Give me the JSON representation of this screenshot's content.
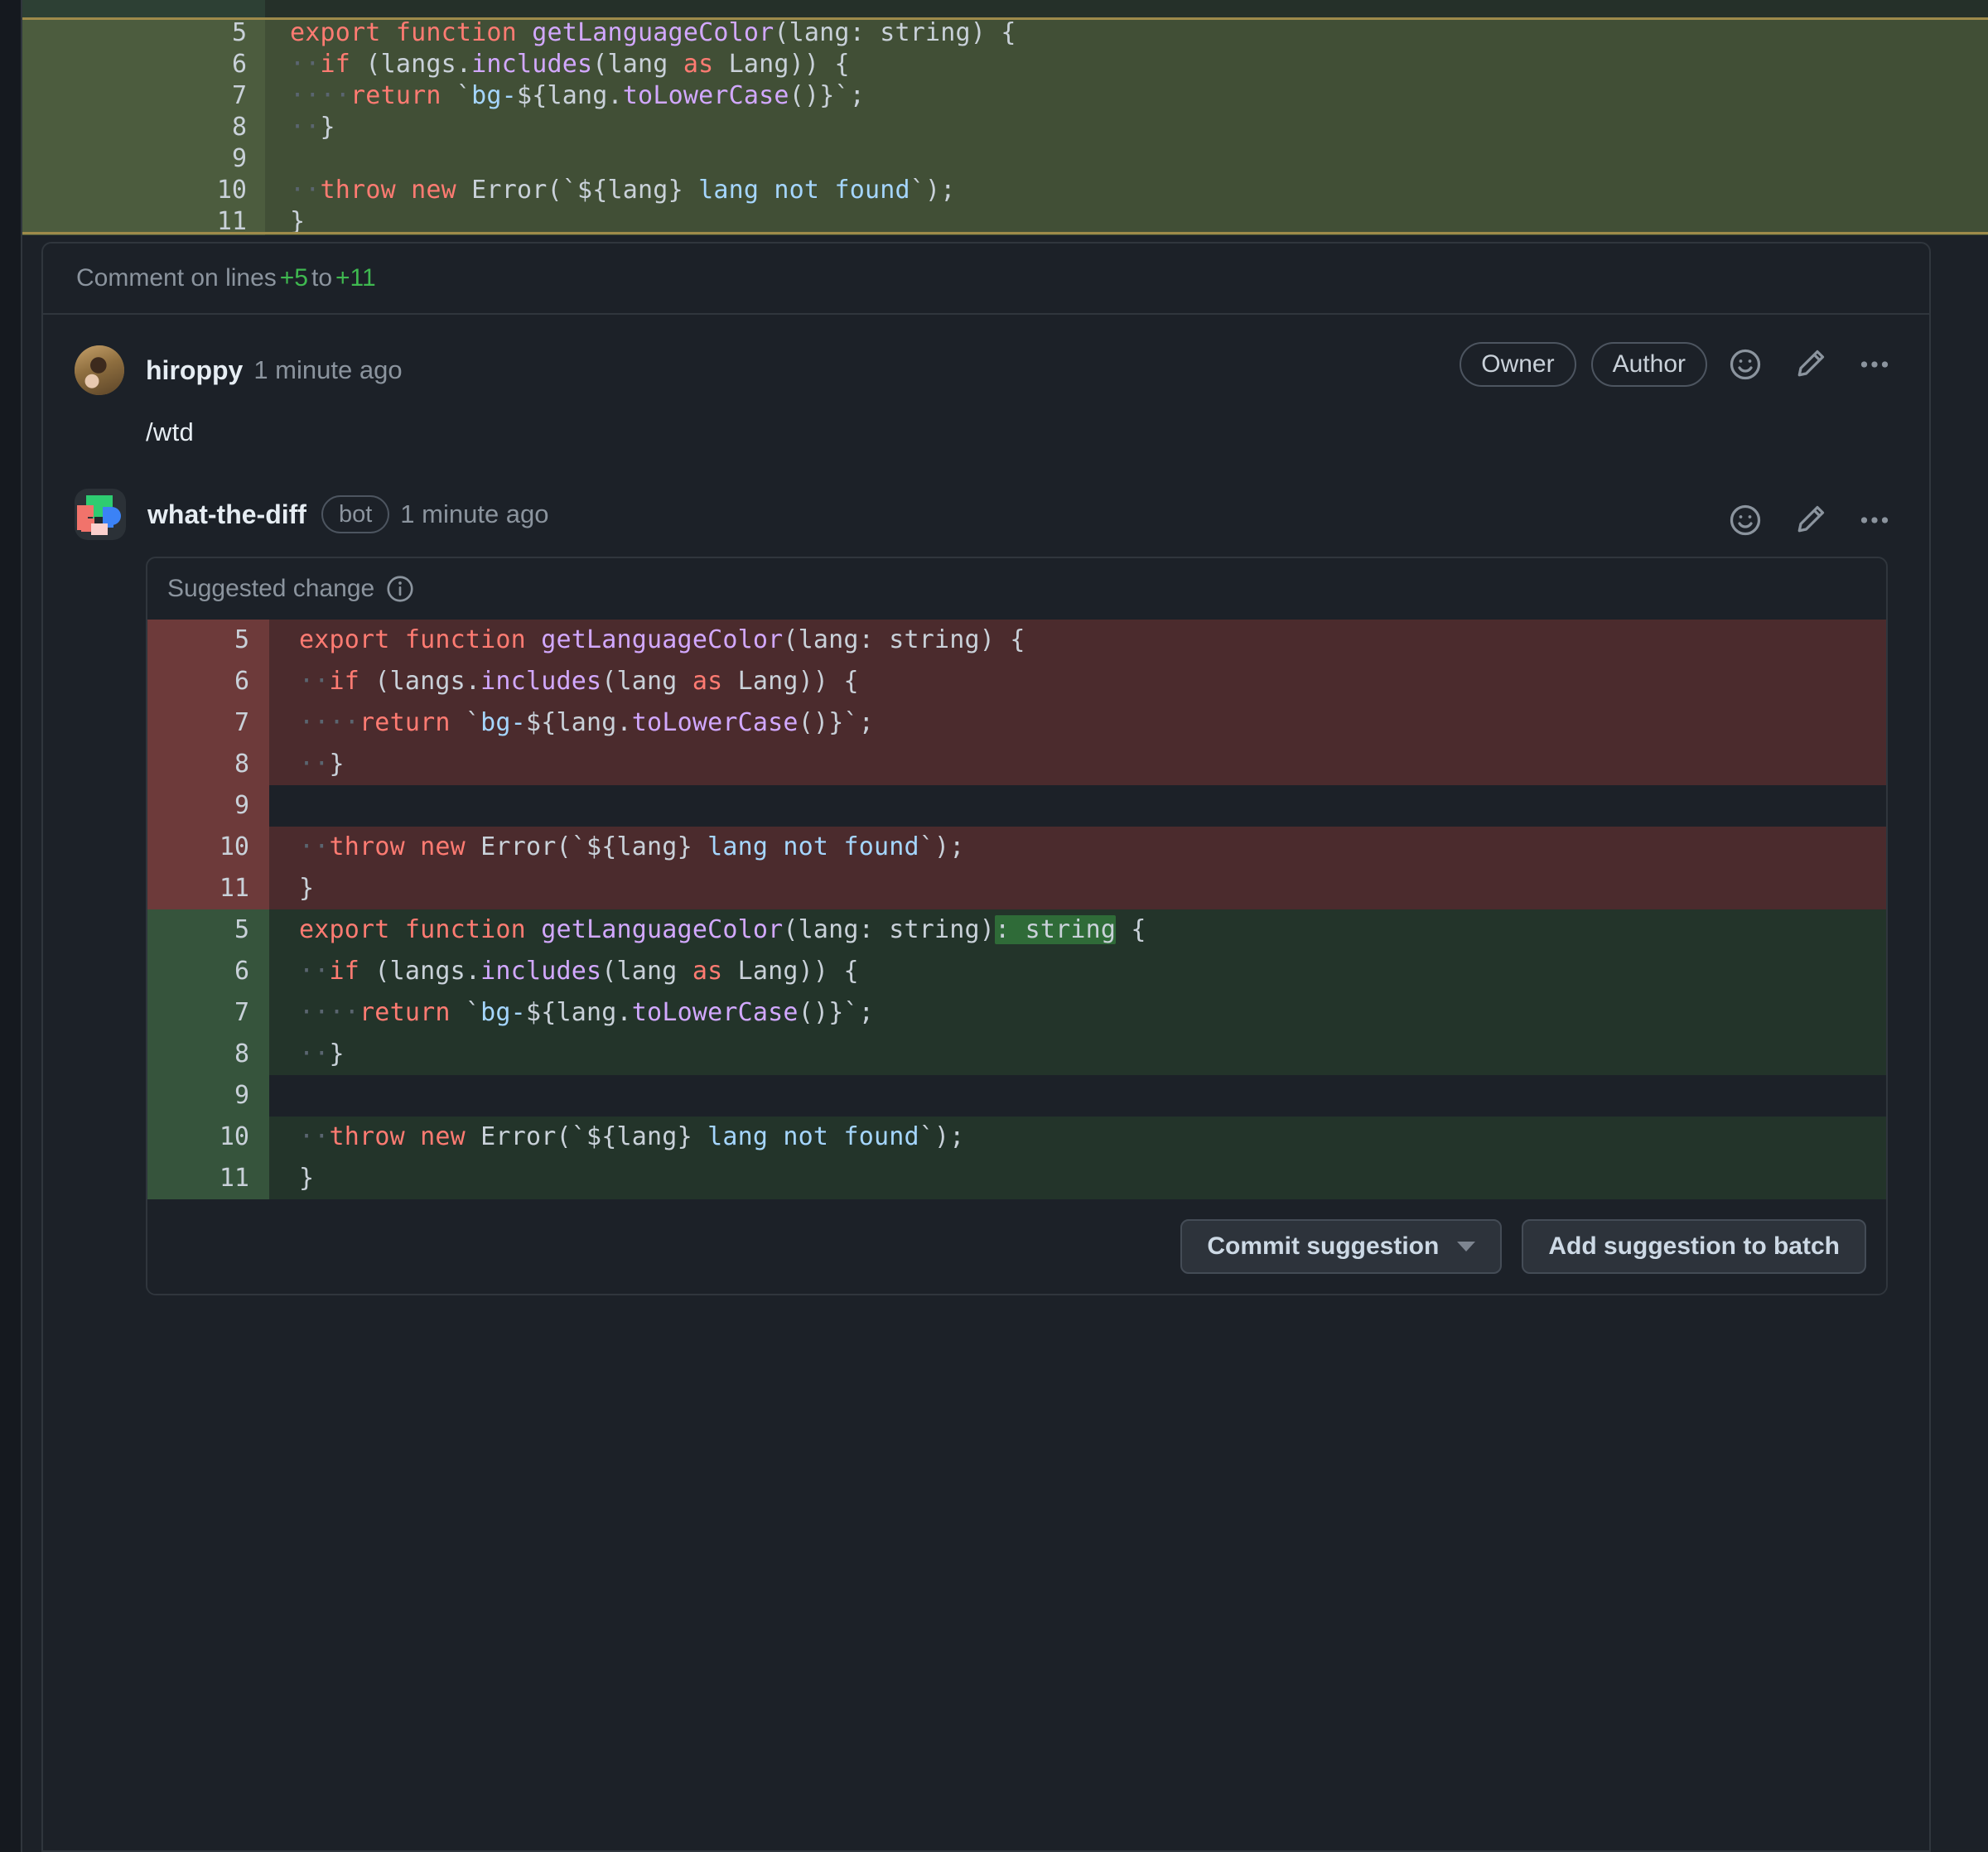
{
  "top_diff": {
    "partial_top_line": "",
    "selection_label": "selected-hunk",
    "lines": [
      {
        "num": "5",
        "segments": [
          {
            "t": "export ",
            "c": "kw"
          },
          {
            "t": "function ",
            "c": "kw"
          },
          {
            "t": "getLanguageColor",
            "c": "fn"
          },
          {
            "t": "(lang: string) {",
            "c": "pl"
          }
        ]
      },
      {
        "num": "6",
        "segments": [
          {
            "t": "··",
            "c": "ws"
          },
          {
            "t": "if",
            "c": "kw"
          },
          {
            "t": " (langs.",
            "c": "pl"
          },
          {
            "t": "includes",
            "c": "fn"
          },
          {
            "t": "(lang ",
            "c": "pl"
          },
          {
            "t": "as",
            "c": "kw"
          },
          {
            "t": " Lang)) {",
            "c": "pl"
          }
        ]
      },
      {
        "num": "7",
        "segments": [
          {
            "t": "····",
            "c": "ws"
          },
          {
            "t": "return",
            "c": "kw"
          },
          {
            "t": " `",
            "c": "pl"
          },
          {
            "t": "bg-",
            "c": "str"
          },
          {
            "t": "${lang.",
            "c": "pl"
          },
          {
            "t": "toLowerCase",
            "c": "fn"
          },
          {
            "t": "()}`;",
            "c": "pl"
          }
        ]
      },
      {
        "num": "8",
        "segments": [
          {
            "t": "··",
            "c": "ws"
          },
          {
            "t": "}",
            "c": "pl"
          }
        ]
      },
      {
        "num": "9",
        "segments": [
          {
            "t": "",
            "c": "pl"
          }
        ]
      },
      {
        "num": "10",
        "segments": [
          {
            "t": "··",
            "c": "ws"
          },
          {
            "t": "throw",
            "c": "kw"
          },
          {
            "t": " ",
            "c": "pl"
          },
          {
            "t": "new",
            "c": "kw"
          },
          {
            "t": " Error(`",
            "c": "pl"
          },
          {
            "t": "${lang}",
            "c": "pl"
          },
          {
            "t": " lang not found",
            "c": "str"
          },
          {
            "t": "`);",
            "c": "pl"
          }
        ]
      },
      {
        "num": "11",
        "segments": [
          {
            "t": "}",
            "c": "pl"
          }
        ]
      }
    ]
  },
  "comment_on_lines": {
    "prefix": "Comment on lines",
    "from": "+5",
    "to_label": "to",
    "to": "+11"
  },
  "comments": [
    {
      "username": "hiroppy",
      "timestamp": "1 minute ago",
      "badges": [
        "Owner",
        "Author"
      ],
      "body": "/wtd",
      "actions": [
        "reaction-icon",
        "edit-icon",
        "kebab-icon"
      ]
    },
    {
      "username": "what-the-diff",
      "bot_label": "bot",
      "timestamp": "1 minute ago",
      "badges": [],
      "actions": [
        "reaction-icon",
        "edit-icon",
        "kebab-icon"
      ]
    }
  ],
  "suggestion": {
    "header": "Suggested change",
    "info_icon": "info-icon",
    "deleted": [
      {
        "num": "5",
        "segments": [
          {
            "t": "export ",
            "c": "kw"
          },
          {
            "t": "function ",
            "c": "kw"
          },
          {
            "t": "getLanguageColor",
            "c": "fn"
          },
          {
            "t": "(lang: string) {",
            "c": "pl"
          }
        ]
      },
      {
        "num": "6",
        "segments": [
          {
            "t": "··",
            "c": "ws"
          },
          {
            "t": "if",
            "c": "kw"
          },
          {
            "t": " (langs.",
            "c": "pl"
          },
          {
            "t": "includes",
            "c": "fn"
          },
          {
            "t": "(lang ",
            "c": "pl"
          },
          {
            "t": "as",
            "c": "kw"
          },
          {
            "t": " Lang)) {",
            "c": "pl"
          }
        ]
      },
      {
        "num": "7",
        "segments": [
          {
            "t": "····",
            "c": "ws"
          },
          {
            "t": "return",
            "c": "kw"
          },
          {
            "t": " `",
            "c": "pl"
          },
          {
            "t": "bg-",
            "c": "str"
          },
          {
            "t": "${lang.",
            "c": "pl"
          },
          {
            "t": "toLowerCase",
            "c": "fn"
          },
          {
            "t": "()}`;",
            "c": "pl"
          }
        ]
      },
      {
        "num": "8",
        "segments": [
          {
            "t": "··",
            "c": "ws"
          },
          {
            "t": "}",
            "c": "pl"
          }
        ]
      },
      {
        "num": "9",
        "segments": [
          {
            "t": "",
            "c": "pl"
          }
        ]
      },
      {
        "num": "10",
        "segments": [
          {
            "t": "··",
            "c": "ws"
          },
          {
            "t": "throw",
            "c": "kw"
          },
          {
            "t": " ",
            "c": "pl"
          },
          {
            "t": "new",
            "c": "kw"
          },
          {
            "t": " Error(`",
            "c": "pl"
          },
          {
            "t": "${lang}",
            "c": "pl"
          },
          {
            "t": " lang not found",
            "c": "str"
          },
          {
            "t": "`);",
            "c": "pl"
          }
        ]
      },
      {
        "num": "11",
        "segments": [
          {
            "t": "}",
            "c": "pl"
          }
        ]
      }
    ],
    "added": [
      {
        "num": "5",
        "segments": [
          {
            "t": "export ",
            "c": "kw"
          },
          {
            "t": "function ",
            "c": "kw"
          },
          {
            "t": "getLanguageColor",
            "c": "fn"
          },
          {
            "t": "(lang: string)",
            "c": "pl"
          },
          {
            "t": ": string",
            "c": "pl wordadd"
          },
          {
            "t": " {",
            "c": "pl"
          }
        ]
      },
      {
        "num": "6",
        "segments": [
          {
            "t": "··",
            "c": "ws"
          },
          {
            "t": "if",
            "c": "kw"
          },
          {
            "t": " (langs.",
            "c": "pl"
          },
          {
            "t": "includes",
            "c": "fn"
          },
          {
            "t": "(lang ",
            "c": "pl"
          },
          {
            "t": "as",
            "c": "kw"
          },
          {
            "t": " Lang)) {",
            "c": "pl"
          }
        ]
      },
      {
        "num": "7",
        "segments": [
          {
            "t": "····",
            "c": "ws"
          },
          {
            "t": "return",
            "c": "kw"
          },
          {
            "t": " `",
            "c": "pl"
          },
          {
            "t": "bg-",
            "c": "str"
          },
          {
            "t": "${lang.",
            "c": "pl"
          },
          {
            "t": "toLowerCase",
            "c": "fn"
          },
          {
            "t": "()}`;",
            "c": "pl"
          }
        ]
      },
      {
        "num": "8",
        "segments": [
          {
            "t": "··",
            "c": "ws"
          },
          {
            "t": "}",
            "c": "pl"
          }
        ]
      },
      {
        "num": "9",
        "segments": [
          {
            "t": "",
            "c": "pl"
          }
        ]
      },
      {
        "num": "10",
        "segments": [
          {
            "t": "··",
            "c": "ws"
          },
          {
            "t": "throw",
            "c": "kw"
          },
          {
            "t": " ",
            "c": "pl"
          },
          {
            "t": "new",
            "c": "kw"
          },
          {
            "t": " Error(`",
            "c": "pl"
          },
          {
            "t": "${lang}",
            "c": "pl"
          },
          {
            "t": " lang not found",
            "c": "str"
          },
          {
            "t": "`);",
            "c": "pl"
          }
        ]
      },
      {
        "num": "11",
        "segments": [
          {
            "t": "}",
            "c": "pl"
          }
        ]
      }
    ],
    "buttons": {
      "commit": "Commit suggestion",
      "batch": "Add suggestion to batch"
    }
  },
  "colors": {
    "page_bg": "#1c2128",
    "border": "#30363d",
    "addition_green": "#3fb950",
    "selection_border": "#9e8a4a",
    "del_gutter": "#6d3a3a",
    "del_code": "#4b2b2d",
    "add_gutter": "#36543c",
    "add_code": "#23342a",
    "word_add": "#2f6b38",
    "muted_text": "#8b949e",
    "primary_text": "#e6edf3"
  }
}
